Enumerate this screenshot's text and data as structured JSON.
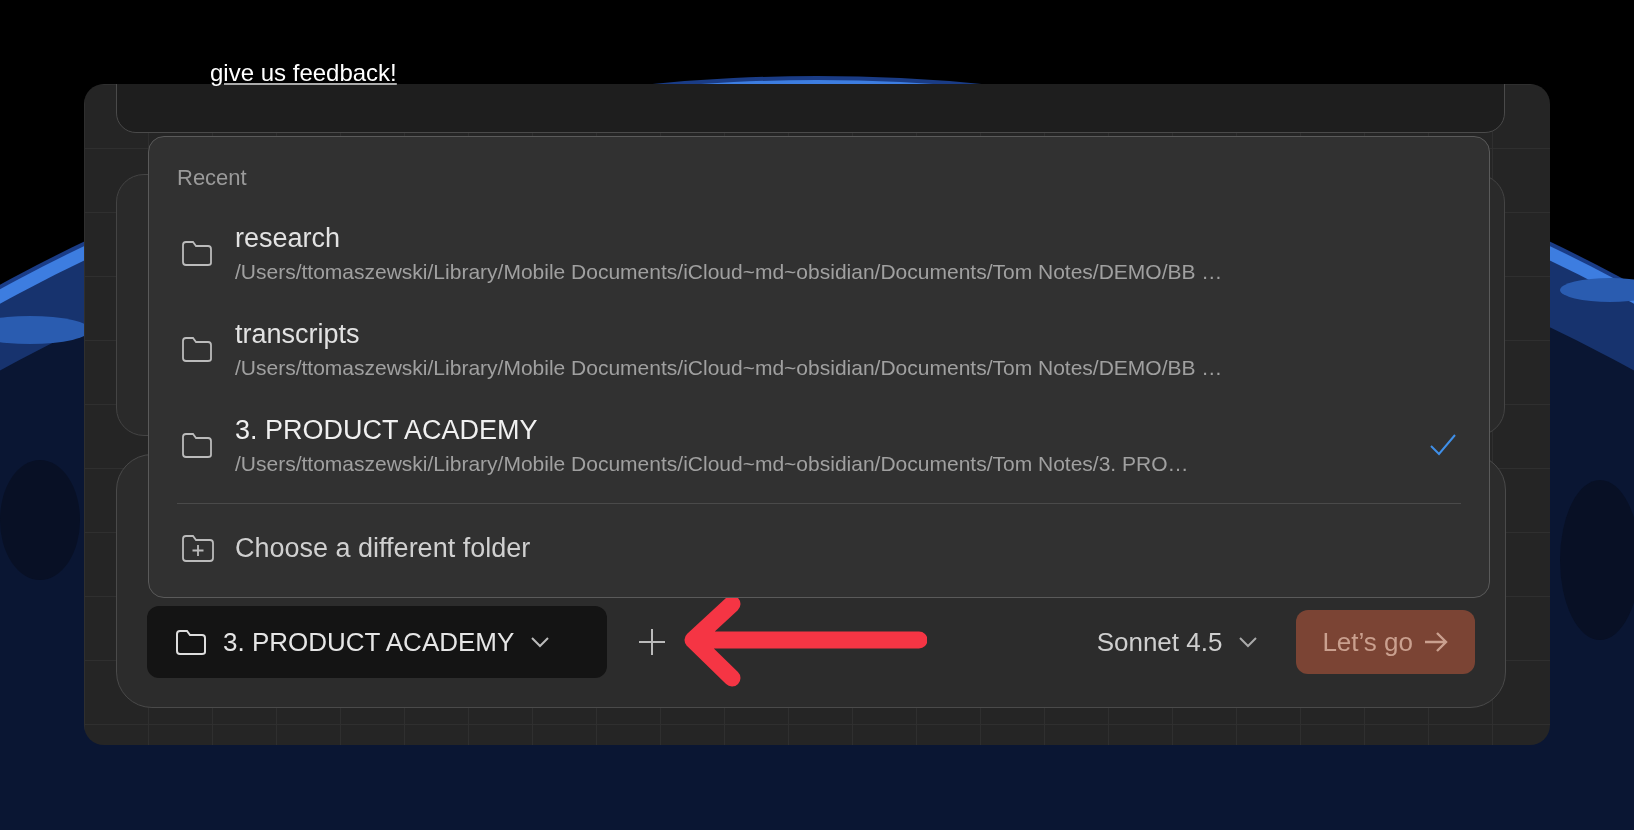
{
  "feedback_link": "give us feedback!",
  "folder_menu": {
    "heading": "Recent",
    "items": [
      {
        "name": "research",
        "path": "/Users/ttomaszewski/Library/Mobile Documents/iCloud~md~obsidian/Documents/Tom Notes/DEMO/BB …",
        "selected": false
      },
      {
        "name": "transcripts",
        "path": "/Users/ttomaszewski/Library/Mobile Documents/iCloud~md~obsidian/Documents/Tom Notes/DEMO/BB …",
        "selected": false
      },
      {
        "name": "3. PRODUCT ACADEMY",
        "path": "/Users/ttomaszewski/Library/Mobile Documents/iCloud~md~obsidian/Documents/Tom Notes/3. PRO…",
        "selected": true
      }
    ],
    "choose_action": "Choose a different folder"
  },
  "composer": {
    "folder_button": "3. PRODUCT ACADEMY",
    "model": "Sonnet 4.5",
    "submit": "Let’s go"
  }
}
